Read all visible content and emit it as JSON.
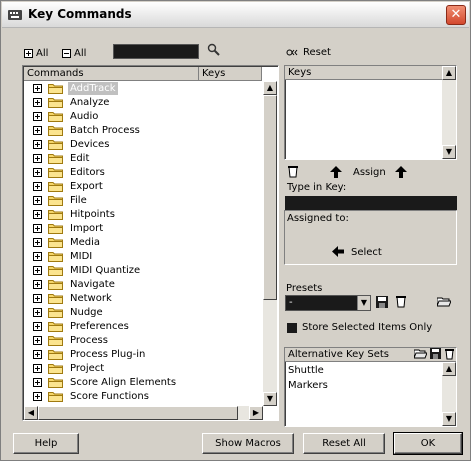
{
  "window": {
    "title": "Key Commands",
    "close_symbol": "✕"
  },
  "toolbar": {
    "expand_all_label": "All",
    "collapse_all_label": "All",
    "search_value": "",
    "reset_label": "Reset"
  },
  "commands_list": {
    "col_commands": "Commands",
    "col_keys": "Keys",
    "items": [
      {
        "label": "AddTrack",
        "selected": true
      },
      {
        "label": "Analyze"
      },
      {
        "label": "Audio"
      },
      {
        "label": "Batch Process"
      },
      {
        "label": "Devices"
      },
      {
        "label": "Edit"
      },
      {
        "label": "Editors"
      },
      {
        "label": "Export"
      },
      {
        "label": "File"
      },
      {
        "label": "Hitpoints"
      },
      {
        "label": "Import"
      },
      {
        "label": "Media"
      },
      {
        "label": "MIDI"
      },
      {
        "label": "MIDI Quantize"
      },
      {
        "label": "Navigate"
      },
      {
        "label": "Network"
      },
      {
        "label": "Nudge"
      },
      {
        "label": "Preferences"
      },
      {
        "label": "Process"
      },
      {
        "label": "Process Plug-in"
      },
      {
        "label": "Project"
      },
      {
        "label": "Score Align Elements"
      },
      {
        "label": "Score Functions"
      }
    ]
  },
  "keys_panel": {
    "header": "Keys",
    "assign_label": "Assign",
    "type_in_key_label": "Type in Key:",
    "type_in_key_value": "",
    "assigned_to_label": "Assigned to:",
    "select_label": "Select"
  },
  "presets": {
    "label": "Presets",
    "selected_value": "-",
    "store_selected_label": "Store Selected Items Only",
    "store_selected_checked": true
  },
  "alt_key_sets": {
    "header": "Alternative Key Sets",
    "items": [
      "Shuttle",
      "Markers"
    ]
  },
  "footer": {
    "help_label": "Help",
    "show_macros_label": "Show Macros",
    "reset_all_label": "Reset All",
    "ok_label": "OK"
  }
}
